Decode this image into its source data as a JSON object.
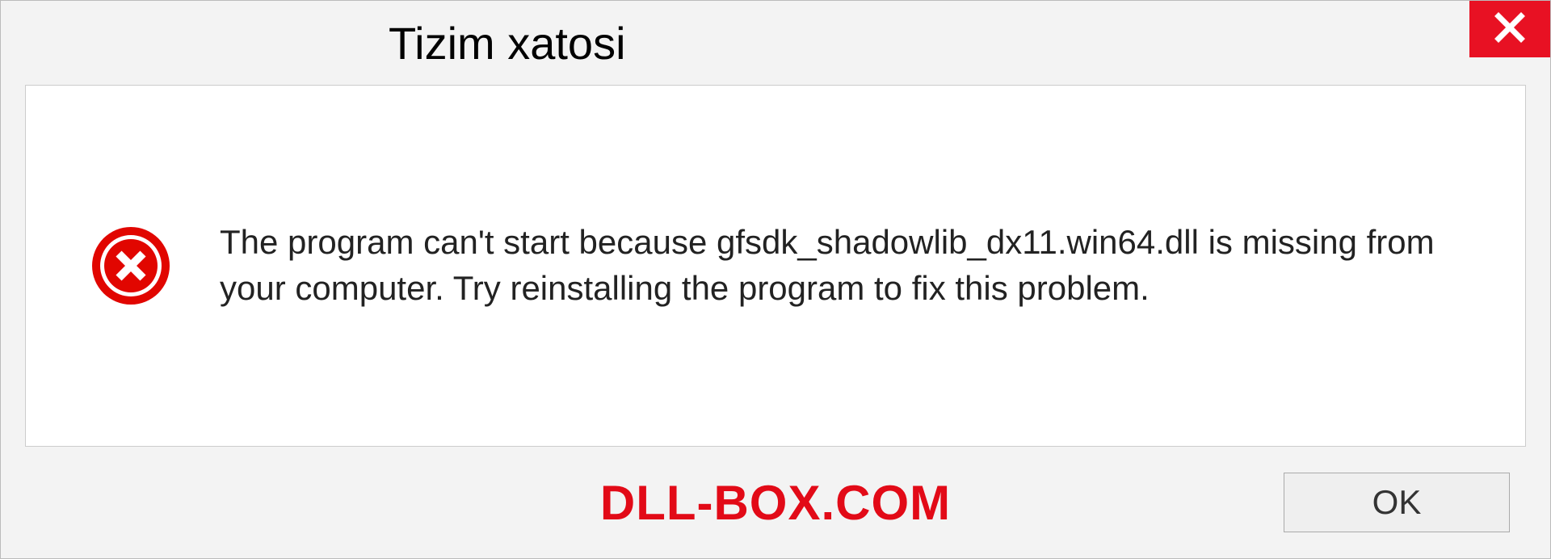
{
  "titlebar": {
    "title": "Tizim xatosi"
  },
  "message": "The program can't start because gfsdk_shadowlib_dx11.win64.dll is missing from your computer. Try reinstalling the program to fix this problem.",
  "footer": {
    "watermark": "DLL-BOX.COM",
    "ok_label": "OK"
  },
  "colors": {
    "close_button": "#e81123",
    "error_icon": "#e10600",
    "watermark": "#e20a17"
  },
  "icons": {
    "close": "close-icon",
    "error": "error-circle-x-icon"
  }
}
